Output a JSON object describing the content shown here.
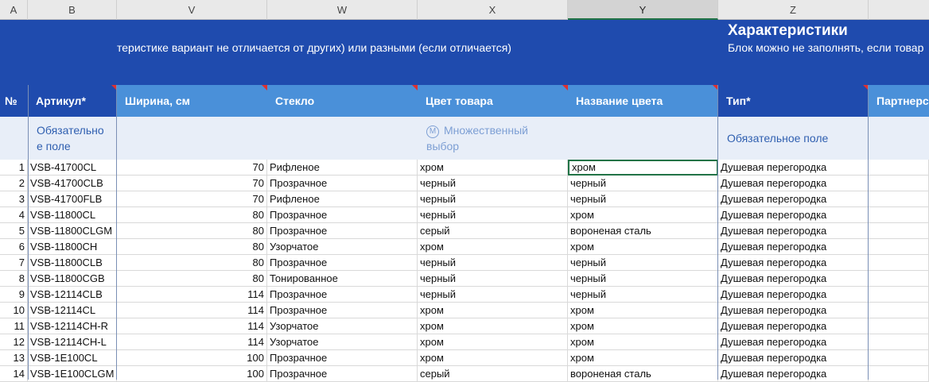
{
  "columns": [
    "A",
    "B",
    "V",
    "W",
    "X",
    "Y",
    "Z"
  ],
  "banner": {
    "description": "теристике вариант не отличается от других) или разными (если отличается)",
    "section_title": "Характеристики",
    "section_subtitle": "Блок можно не заполнять, если товар"
  },
  "headers": {
    "num": "№",
    "article": "Артикул*",
    "width": "Ширина, см",
    "glass": "Стекло",
    "color": "Цвет товара",
    "color_name": "Название цвета",
    "type": "Тип*",
    "partner": "Партнерс"
  },
  "notes": {
    "article_line1": "Обязательно",
    "article_line2": "е поле",
    "multi_icon": "M",
    "multi_line1": "Множественный",
    "multi_line2": "выбор",
    "type": "Обязательное поле"
  },
  "rows": [
    {
      "n": "1",
      "article": "VSB-41700CL",
      "width": "70",
      "glass": "Рифленое",
      "color": "хром",
      "color_name": "хром",
      "type": "Душевая перегородка"
    },
    {
      "n": "2",
      "article": "VSB-41700CLB",
      "width": "70",
      "glass": "Прозрачное",
      "color": "черный",
      "color_name": "черный",
      "type": "Душевая перегородка"
    },
    {
      "n": "3",
      "article": "VSB-41700FLB",
      "width": "70",
      "glass": "Рифленое",
      "color": "черный",
      "color_name": "черный",
      "type": "Душевая перегородка"
    },
    {
      "n": "4",
      "article": "VSB-11800CL",
      "width": "80",
      "glass": "Прозрачное",
      "color": "черный",
      "color_name": "хром",
      "type": "Душевая перегородка"
    },
    {
      "n": "5",
      "article": "VSB-11800CLGM",
      "width": "80",
      "glass": "Прозрачное",
      "color": "серый",
      "color_name": "вороненая сталь",
      "type": "Душевая перегородка"
    },
    {
      "n": "6",
      "article": "VSB-11800CH",
      "width": "80",
      "glass": "Узорчатое",
      "color": "хром",
      "color_name": "хром",
      "type": "Душевая перегородка"
    },
    {
      "n": "7",
      "article": "VSB-11800CLB",
      "width": "80",
      "glass": "Прозрачное",
      "color": "черный",
      "color_name": "черный",
      "type": "Душевая перегородка"
    },
    {
      "n": "8",
      "article": "VSB-11800CGB",
      "width": "80",
      "glass": "Тонированное",
      "color": "черный",
      "color_name": "черный",
      "type": "Душевая перегородка"
    },
    {
      "n": "9",
      "article": "VSB-12114CLB",
      "width": "114",
      "glass": "Прозрачное",
      "color": "черный",
      "color_name": "черный",
      "type": "Душевая перегородка"
    },
    {
      "n": "10",
      "article": "VSB-12114CL",
      "width": "114",
      "glass": "Прозрачное",
      "color": "хром",
      "color_name": "хром",
      "type": "Душевая перегородка"
    },
    {
      "n": "11",
      "article": "VSB-12114CH-R",
      "width": "114",
      "glass": "Узорчатое",
      "color": "хром",
      "color_name": "хром",
      "type": "Душевая перегородка"
    },
    {
      "n": "12",
      "article": "VSB-12114CH-L",
      "width": "114",
      "glass": "Узорчатое",
      "color": "хром",
      "color_name": "хром",
      "type": "Душевая перегородка"
    },
    {
      "n": "13",
      "article": "VSB-1E100CL",
      "width": "100",
      "glass": "Прозрачное",
      "color": "хром",
      "color_name": "хром",
      "type": "Душевая перегородка"
    },
    {
      "n": "14",
      "article": "VSB-1E100CLGM",
      "width": "100",
      "glass": "Прозрачное",
      "color": "серый",
      "color_name": "вороненая сталь",
      "type": "Душевая перегородка"
    }
  ],
  "colors": {
    "banner": "#1f4bae",
    "header": "#4a90d9",
    "note_bg": "#e8eef8",
    "selection": "#217346"
  }
}
